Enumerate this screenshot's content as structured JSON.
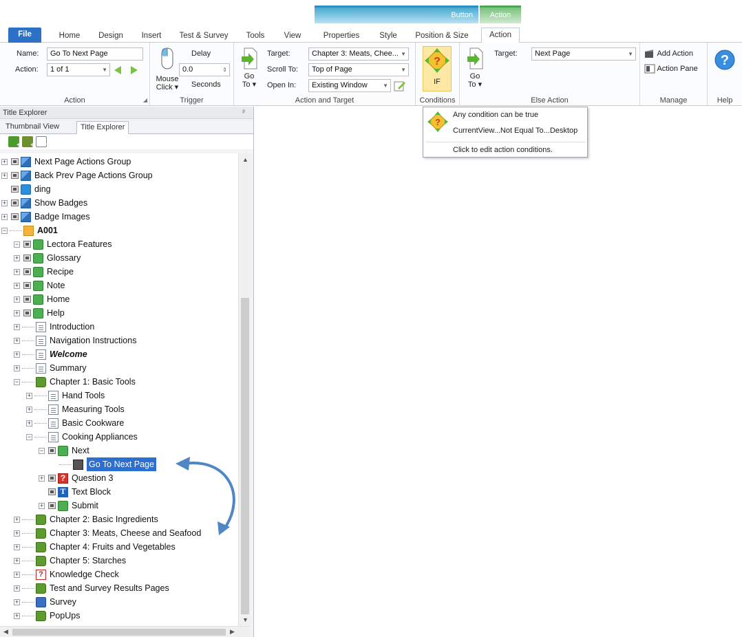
{
  "context_groups": {
    "button": "Button",
    "action": "Action"
  },
  "tabs": [
    "File",
    "Home",
    "Design",
    "Insert",
    "Test & Survey",
    "Tools",
    "View",
    "Properties",
    "Style",
    "Position & Size",
    "Action"
  ],
  "ribbon": {
    "action_group": {
      "name_label": "Name:",
      "name_value": "Go To Next Page",
      "action_label": "Action:",
      "action_value": "1 of 1",
      "group_label": "Action"
    },
    "trigger_group": {
      "mouse_click": "Mouse",
      "mouse_click2": "Click",
      "delay_label": "Delay",
      "delay_value": "0.0",
      "seconds": "Seconds",
      "group_label": "Trigger"
    },
    "target_group": {
      "go_to": "Go",
      "go_to2": "To",
      "target_label": "Target:",
      "target_value": "Chapter 3: Meats, Chee...",
      "scroll_label": "Scroll To:",
      "scroll_value": "Top of Page",
      "open_label": "Open In:",
      "open_value": "Existing Window",
      "group_label": "Action and Target"
    },
    "conditions_group": {
      "if_label": "IF",
      "group_label": "Conditions"
    },
    "else_group": {
      "go_to": "Go",
      "go_to2": "To",
      "target_label": "Target:",
      "target_value": "Next Page",
      "group_label": "Else Action"
    },
    "manage_group": {
      "add_action": "Add Action",
      "action_pane": "Action Pane",
      "group_label": "Manage"
    },
    "help_group": {
      "group_label": "Help"
    }
  },
  "tooltip": {
    "line1": "Any condition can be true",
    "line2": "CurrentView...Not Equal To...Desktop",
    "footer": "Click to edit action conditions."
  },
  "pane": {
    "title": "Title Explorer",
    "tab1": "Thumbnail View",
    "tab2": "Title Explorer"
  },
  "tree": [
    {
      "label": "Next Page Actions Group",
      "icon": "group"
    },
    {
      "label": "Back Prev Page Actions Group",
      "icon": "group"
    },
    {
      "label": "ding",
      "icon": "audio"
    },
    {
      "label": "Show Badges",
      "icon": "group"
    },
    {
      "label": "Badge Images",
      "icon": "group"
    },
    {
      "label": "A001",
      "icon": "folder"
    },
    {
      "label": "Lectora Features",
      "icon": "button"
    },
    {
      "label": "Glossary",
      "icon": "button"
    },
    {
      "label": "Recipe",
      "icon": "button"
    },
    {
      "label": "Note",
      "icon": "button"
    },
    {
      "label": "Home",
      "icon": "button"
    },
    {
      "label": "Help",
      "icon": "button"
    },
    {
      "label": "Introduction",
      "icon": "page"
    },
    {
      "label": "Navigation Instructions",
      "icon": "page"
    },
    {
      "label": "Welcome",
      "icon": "page"
    },
    {
      "label": "Summary",
      "icon": "page"
    },
    {
      "label": "Chapter 1: Basic Tools",
      "icon": "chapter"
    },
    {
      "label": "Hand Tools",
      "icon": "page"
    },
    {
      "label": "Measuring Tools",
      "icon": "page"
    },
    {
      "label": "Basic Cookware",
      "icon": "page"
    },
    {
      "label": "Cooking Appliances",
      "icon": "page"
    },
    {
      "label": "Next",
      "icon": "button"
    },
    {
      "label": "Go To Next Page",
      "icon": "action"
    },
    {
      "label": "Question 3",
      "icon": "question"
    },
    {
      "label": "Text Block",
      "icon": "textblock"
    },
    {
      "label": "Submit",
      "icon": "button"
    },
    {
      "label": "Chapter 2: Basic Ingredients",
      "icon": "chapter"
    },
    {
      "label": "Chapter 3: Meats, Cheese and Seafood",
      "icon": "chapter"
    },
    {
      "label": "Chapter 4: Fruits and Vegetables",
      "icon": "chapter"
    },
    {
      "label": "Chapter 5: Starches",
      "icon": "chapter"
    },
    {
      "label": "Knowledge Check",
      "icon": "test"
    },
    {
      "label": "Test and Survey Results Pages",
      "icon": "chapter"
    },
    {
      "label": "Survey",
      "icon": "survey"
    },
    {
      "label": "PopUps",
      "icon": "chapter"
    }
  ],
  "colors": {
    "accent": "#2a71c7",
    "selection": "#2d6fce",
    "annotation_arrow": "#4f86c6"
  }
}
